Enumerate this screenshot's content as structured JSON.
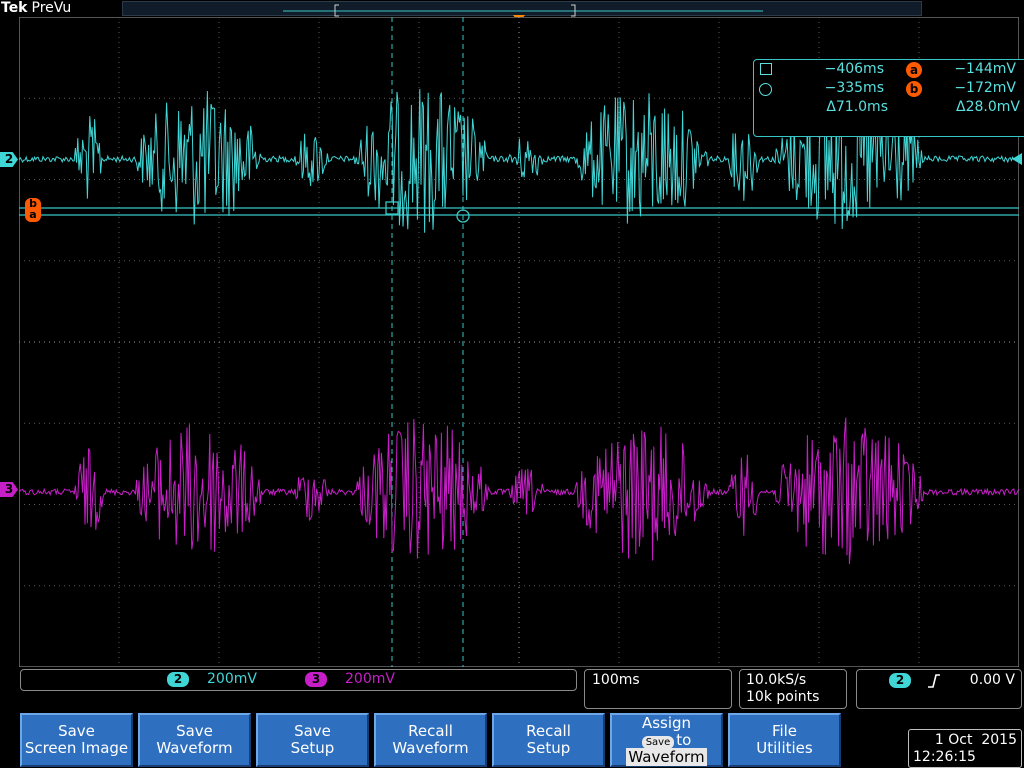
{
  "header": {
    "brand": "Tek",
    "mode": "PreVu"
  },
  "screen": {
    "channel_markers": [
      {
        "id": "ch2",
        "label": "2",
        "color": "#41d6d6"
      },
      {
        "id": "ch3",
        "label": "3",
        "color": "#c71fc7"
      }
    ],
    "cursor_marker_label": "b\na",
    "readout": {
      "cursor1_time": "−406ms",
      "cursor2_time": "−335ms",
      "delta_time": "Δ71.0ms",
      "cursor_a_label": "a",
      "cursor_b_label": "b",
      "cursor_a_value": "−144mV",
      "cursor_b_value": "−172mV",
      "delta_value": "Δ28.0mV"
    }
  },
  "status": {
    "ch2_label": "2",
    "ch2_scale": "200mV",
    "ch3_label": "3",
    "ch3_scale": "200mV",
    "timebase": "100ms",
    "sample_rate": "10.0kS/s",
    "record_length": "10k points",
    "trigger_channel": "2",
    "trigger_level": "0.00 V"
  },
  "softkeys": {
    "save_screen_image": [
      "Save",
      "Screen Image"
    ],
    "save_waveform": [
      "Save",
      "Waveform"
    ],
    "save_setup": [
      "Save",
      "Setup"
    ],
    "recall_waveform": [
      "Recall",
      "Waveform"
    ],
    "recall_setup": [
      "Recall",
      "Setup"
    ],
    "assign": {
      "line1": "Assign",
      "chip": "Save",
      "to": "to",
      "line3": "Waveform"
    },
    "file_utilities": [
      "File",
      "Utilities"
    ]
  },
  "clock": {
    "date": "1 Oct  2015",
    "time": "12:26:15"
  },
  "colors": {
    "ch2": "#41d6d6",
    "ch3": "#c71fc7",
    "cursor_badge": "#ff5a00",
    "softkey": "#2f6fc0"
  }
}
